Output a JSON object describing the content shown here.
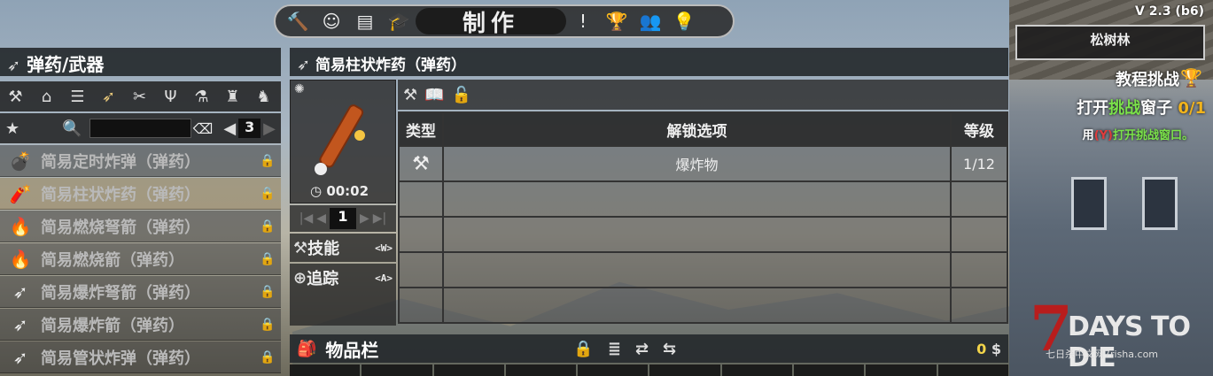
{
  "top_tabs": [
    {
      "icon": "hammer-icon",
      "glyph": "🔨"
    },
    {
      "icon": "character-icon",
      "glyph": "☺"
    },
    {
      "icon": "map-icon",
      "glyph": "▤"
    },
    {
      "icon": "skills-cap-icon",
      "glyph": "🎓"
    },
    {
      "label": "制作",
      "active": true
    },
    {
      "icon": "challenge-icon",
      "glyph": "!"
    },
    {
      "icon": "trophy-icon",
      "glyph": "🏆"
    },
    {
      "icon": "players-icon",
      "glyph": "👥"
    },
    {
      "icon": "tips-bulb-icon",
      "glyph": "💡"
    }
  ],
  "version": "V 2.3 (b6)",
  "biome": "松树林",
  "challenge": {
    "title": "教程挑战",
    "task_prefix": "打开",
    "task_highlight": "挑战",
    "task_suffix": "窗子",
    "progress": "0/1",
    "hint_prefix": "用",
    "hint_key": "(Y)",
    "hint_text": "打开挑战窗口。"
  },
  "left_panel": {
    "title": "弹药/武器",
    "categories": [
      "hammer-icon",
      "home-icon",
      "workbench-icon",
      "ammo-icon",
      "tools-icon",
      "fork-icon",
      "chemistry-icon",
      "armor-icon",
      "chair-icon"
    ],
    "search_placeholder": "",
    "page": "3",
    "recipes": [
      {
        "name": "简易定时炸弹（弹药）",
        "selected": false
      },
      {
        "name": "简易柱状炸药（弹药）",
        "selected": true
      },
      {
        "name": "简易燃烧弩箭（弹药）",
        "selected": false
      },
      {
        "name": "简易燃烧箭（弹药）",
        "selected": false
      },
      {
        "name": "简易爆炸弩箭（弹药）",
        "selected": false
      },
      {
        "name": "简易爆炸箭（弹药）",
        "selected": false
      },
      {
        "name": "简易管状炸弹（弹药）",
        "selected": false
      }
    ]
  },
  "center_panel": {
    "title": "简易柱状炸药（弹药）",
    "craft_time": "00:02",
    "quantity": "1",
    "skill_label": "技能",
    "skill_key": "<W>",
    "track_label": "追踪",
    "track_key": "<A>",
    "unlock_table": {
      "headers": [
        "类型",
        "解锁选项",
        "等级"
      ],
      "rows": [
        {
          "type_icon": "hammer-icon",
          "option": "爆炸物",
          "level": "1/12"
        },
        {
          "type_icon": "",
          "option": "",
          "level": ""
        },
        {
          "type_icon": "",
          "option": "",
          "level": ""
        },
        {
          "type_icon": "",
          "option": "",
          "level": ""
        },
        {
          "type_icon": "",
          "option": "",
          "level": ""
        }
      ]
    }
  },
  "inventory": {
    "title": "物品栏",
    "coins": "0"
  },
  "logo": {
    "main": "DAYS TO DIE",
    "digit": "7",
    "site": "七日杀中文网7risha.com"
  },
  "colors": {
    "accent_green": "#7be34a",
    "progress_gold": "#f2b41c",
    "key_red": "#e03c3c",
    "logo_red": "#b81d1d"
  }
}
